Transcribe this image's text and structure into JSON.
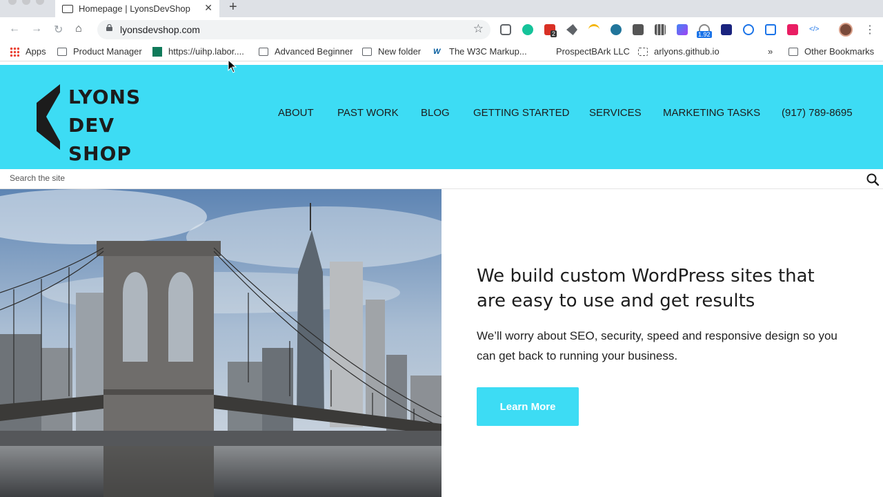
{
  "browser": {
    "tab_title": "Homepage | LyonsDevShop",
    "url": "lyonsdevshop.com",
    "extension_badges": {
      "pocket": "2",
      "speed": "1.92"
    }
  },
  "bookmarks": {
    "items": [
      {
        "label": "Apps"
      },
      {
        "label": "Product Manager"
      },
      {
        "label": "https://uihp.labor...."
      },
      {
        "label": "Advanced Beginner"
      },
      {
        "label": "New folder"
      },
      {
        "label": "The W3C Markup..."
      },
      {
        "label": "ProspectBArk LLC"
      },
      {
        "label": "arlyons.github.io"
      }
    ],
    "overflow": "»",
    "other": "Other Bookmarks"
  },
  "site": {
    "logo_lines": [
      "LYONS",
      "DEV",
      "SHOP"
    ],
    "nav": [
      "ABOUT",
      "PAST WORK",
      "BLOG",
      "GETTING STARTED",
      "SERVICES",
      "MARKETING TASKS",
      "(917) 789-8695"
    ],
    "search_placeholder": "Search the site",
    "hero": {
      "headline": "We build custom WordPress sites that are easy to use and get results",
      "subtext": "We’ll worry about SEO, security, speed and responsive design so you can get back to running your business.",
      "cta": "Learn More"
    }
  },
  "colors": {
    "brand": "#3ddcf4",
    "text_dark": "#1c1c1c"
  }
}
